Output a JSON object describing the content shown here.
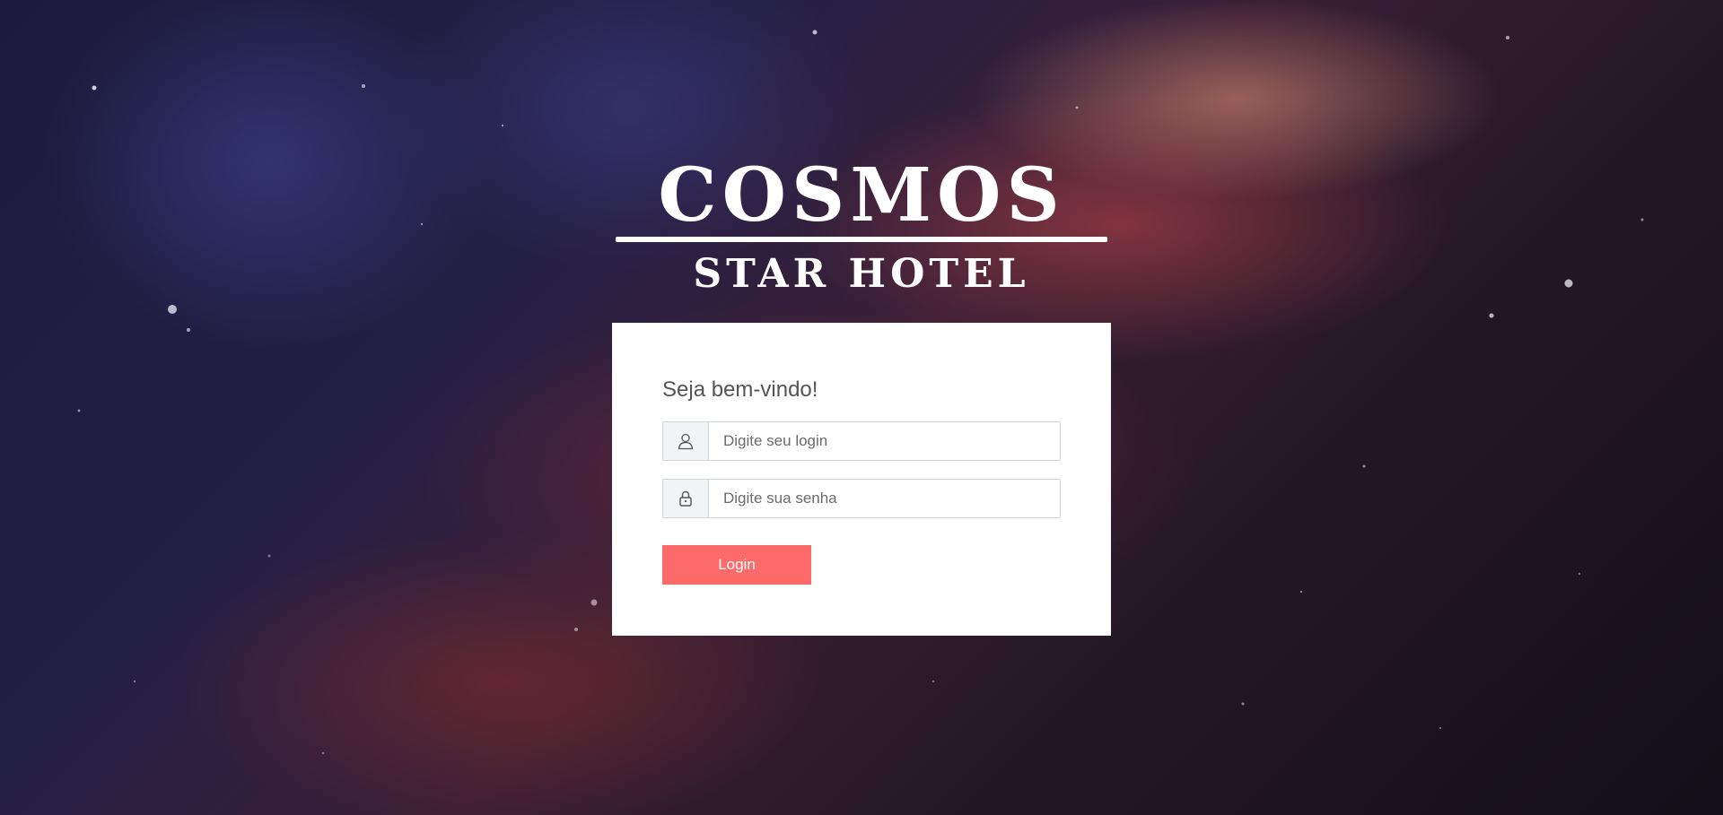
{
  "brand": {
    "name": "COSMOS",
    "subtitle": "STAR HOTEL"
  },
  "login_form": {
    "welcome": "Seja bem-vindo!",
    "login_placeholder": "Digite seu login",
    "password_placeholder": "Digite sua senha",
    "login_button": "Login",
    "login_icon": "user-icon",
    "password_icon": "lock-icon"
  },
  "colors": {
    "accent": "#fd6a6a",
    "card_background": "#ffffff",
    "brand_text": "#ffffff"
  }
}
